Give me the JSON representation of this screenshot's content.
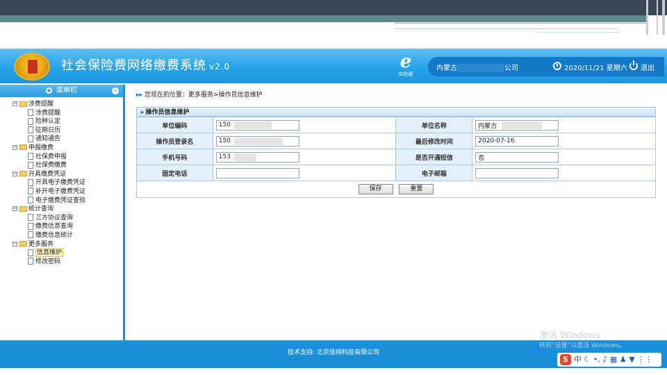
{
  "system": {
    "title": "社会保险费网络缴费系统",
    "version": "v2.0",
    "ie_label": "IE检测",
    "company_prefix": "内蒙古",
    "company_suffix": "公司",
    "date": "2020/11/21 星期六",
    "logout": "退出"
  },
  "sidebar": {
    "title": "菜单栏",
    "groups": [
      {
        "label": "涉费提醒",
        "items": [
          "涉费提醒",
          "险种认定",
          "征期日历",
          "通知通告"
        ]
      },
      {
        "label": "申报缴费",
        "items": [
          "社保费申报",
          "社保费缴费"
        ]
      },
      {
        "label": "开具缴费凭证",
        "items": [
          "开具电子缴费凭证",
          "补开电子缴费凭证",
          "电子缴费凭证查验"
        ]
      },
      {
        "label": "统计查询",
        "items": [
          "三方协议查询",
          "缴费信息查询",
          "缴费信息统计"
        ]
      },
      {
        "label": "更多服务",
        "items": [
          "信息维护",
          "修改密码"
        ]
      }
    ]
  },
  "breadcrumb": "您现在的位置：更多服务>操作员信息维护",
  "panel_title": "操作员信息维护",
  "form": {
    "unit_code_label": "单位编码",
    "unit_code_value": "150",
    "unit_name_label": "单位名称",
    "unit_name_prefix": "内蒙古",
    "unit_name_suffix": "公司",
    "login_name_label": "操作员登录名",
    "login_name_value": "150",
    "last_modified_label": "最后修改时间",
    "last_modified_value": "2020-07-16",
    "mobile_label": "手机号码",
    "mobile_value": "153",
    "sms_label": "是否开通短信",
    "sms_value": "否",
    "phone_label": "固定电话",
    "phone_value": "",
    "email_label": "电子邮箱",
    "email_value": ""
  },
  "buttons": {
    "save": "保存",
    "reset": "重置"
  },
  "footer": "技术支持: 北京佳网科技有限公司",
  "watermark": {
    "line1": "激活 Windows",
    "line2": "转到“设置”以激活 Windows。"
  },
  "ime": {
    "lang": "中"
  }
}
